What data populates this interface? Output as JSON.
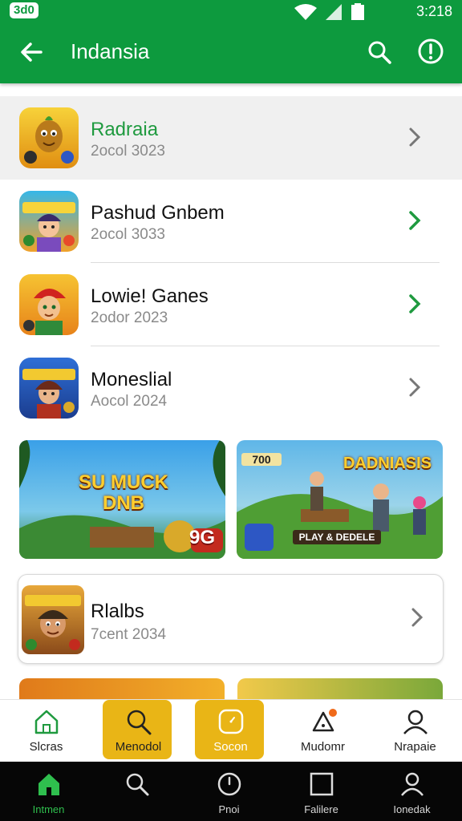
{
  "status_bar": {
    "carrier": "3d0",
    "time": "3:218"
  },
  "app_bar": {
    "title": "Indansia"
  },
  "list_items": [
    {
      "title": "Radraia",
      "subtitle": "2ocol 3023"
    },
    {
      "title": "Pashud Gnbem",
      "subtitle": "2ocol 3033"
    },
    {
      "title": "Lowie! Ganes",
      "subtitle": "2odor 2023"
    },
    {
      "title": "Moneslial",
      "subtitle": "Aocol 2024"
    }
  ],
  "banners": [
    {
      "text_1": "SU MUCK DNB",
      "badge": "9G"
    },
    {
      "corner": "700",
      "text_1": "DADNIASIS",
      "text_2": "PLAY & DEDELE"
    }
  ],
  "card": {
    "title": "Rlalbs",
    "subtitle": "7cent 2034"
  },
  "bottom_nav": [
    {
      "label": "Slcras",
      "icon": "home-outline-icon"
    },
    {
      "label": "Menodol",
      "icon": "search-icon"
    },
    {
      "label": "Socon",
      "icon": "clock-icon"
    },
    {
      "label": "Mudomr",
      "icon": "bell-icon"
    },
    {
      "label": "Nrapaie",
      "icon": "profile-icon"
    }
  ],
  "system_nav": [
    {
      "label": "Intmen",
      "icon": "home-icon"
    },
    {
      "label": "",
      "icon": "search-icon"
    },
    {
      "label": "Pnoi",
      "icon": "clock-icon"
    },
    {
      "label": "Falilere",
      "icon": "square-icon"
    },
    {
      "label": "Ionedak",
      "icon": "profile-icon"
    }
  ],
  "colors": {
    "brand_green": "#0d9a3e",
    "accent_yellow": "#e9b516",
    "chevron_green": "#1f9a3f"
  }
}
